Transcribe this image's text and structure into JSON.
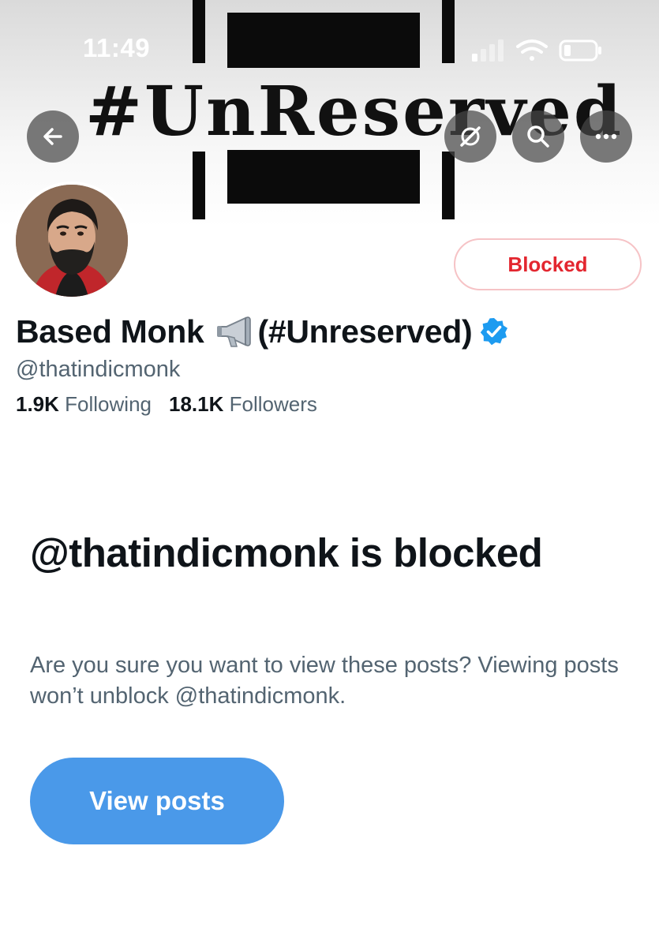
{
  "status_bar": {
    "time": "11:49"
  },
  "banner": {
    "title": "#UnReserved"
  },
  "profile": {
    "display_name": "Based Monk",
    "name_suffix": "(#Unreserved)",
    "handle": "@thatindicmonk",
    "following_count": "1.9K",
    "following_label": "Following",
    "followers_count": "18.1K",
    "followers_label": "Followers",
    "verified": true
  },
  "actions": {
    "blocked_label": "Blocked"
  },
  "blocked_notice": {
    "title": "@thatindicmonk is blocked",
    "body": "Are you sure you want to view these posts? Viewing posts won’t unblock @thatindicmonk.",
    "view_button": "View posts"
  },
  "icons": {
    "back": "arrow-left-icon",
    "grok": "grok-icon",
    "search": "search-icon",
    "more": "more-icon",
    "megaphone": "megaphone-icon",
    "verified": "verified-badge-icon"
  },
  "colors": {
    "accent": "#4a99e9",
    "blocked_text": "#e3262f",
    "blocked_border": "#f6c3c6",
    "verified": "#1d9bf0",
    "secondary_text": "#536471"
  }
}
